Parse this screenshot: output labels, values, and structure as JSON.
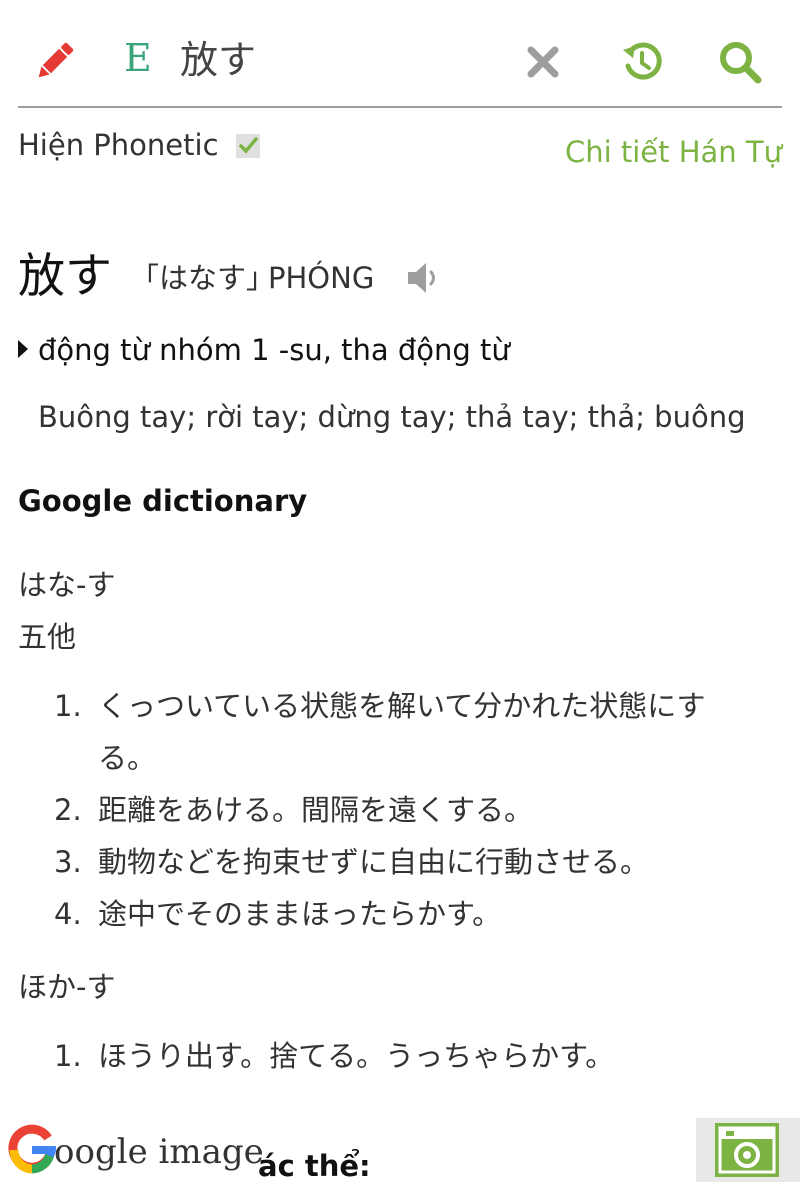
{
  "toolbar": {
    "lang_badge": "E",
    "search_value": "放す"
  },
  "phonetic": {
    "label": "Hiện Phonetic",
    "checked": true,
    "hanja_link": "Chi tiết Hán Tự"
  },
  "word": {
    "kanji": "放す",
    "reading": "「はなす」",
    "hanviet": "PHÓNG",
    "part_of_speech": "động từ nhóm 1 -su, tha động từ",
    "meaning": "Buông tay; rời tay; dừng tay; thả tay; thả; buông"
  },
  "google_dictionary": {
    "title": "Google dictionary",
    "entries": [
      {
        "head": "はな-す",
        "sub": "五他",
        "definitions": [
          {
            "num": "1.",
            "text": "くっついている状態を解いて分かれた状態にす",
            "cont": "る。"
          },
          {
            "num": "2.",
            "text": "距離をあける。間隔を遠くする。"
          },
          {
            "num": "3.",
            "text": "動物などを拘束せずに自由に行動させる。"
          },
          {
            "num": "4.",
            "text": "途中でそのままほったらかす。"
          }
        ]
      },
      {
        "head": "ほか-す",
        "definitions": [
          {
            "num": "1.",
            "text": "ほうり出す。捨てる。うっちゃらかす。"
          }
        ]
      }
    ]
  },
  "footer": {
    "google_image_label": "oogle image",
    "partial_text": "ác thể:"
  },
  "colors": {
    "accent_green": "#7cb342",
    "pencil_red": "#e53935",
    "badge_teal": "#3aa57a",
    "divider": "#9e9e9e"
  },
  "icons": [
    "pencil-icon",
    "clear-icon",
    "history-icon",
    "search-icon",
    "speaker-icon",
    "camera-icon",
    "google-g-icon"
  ]
}
